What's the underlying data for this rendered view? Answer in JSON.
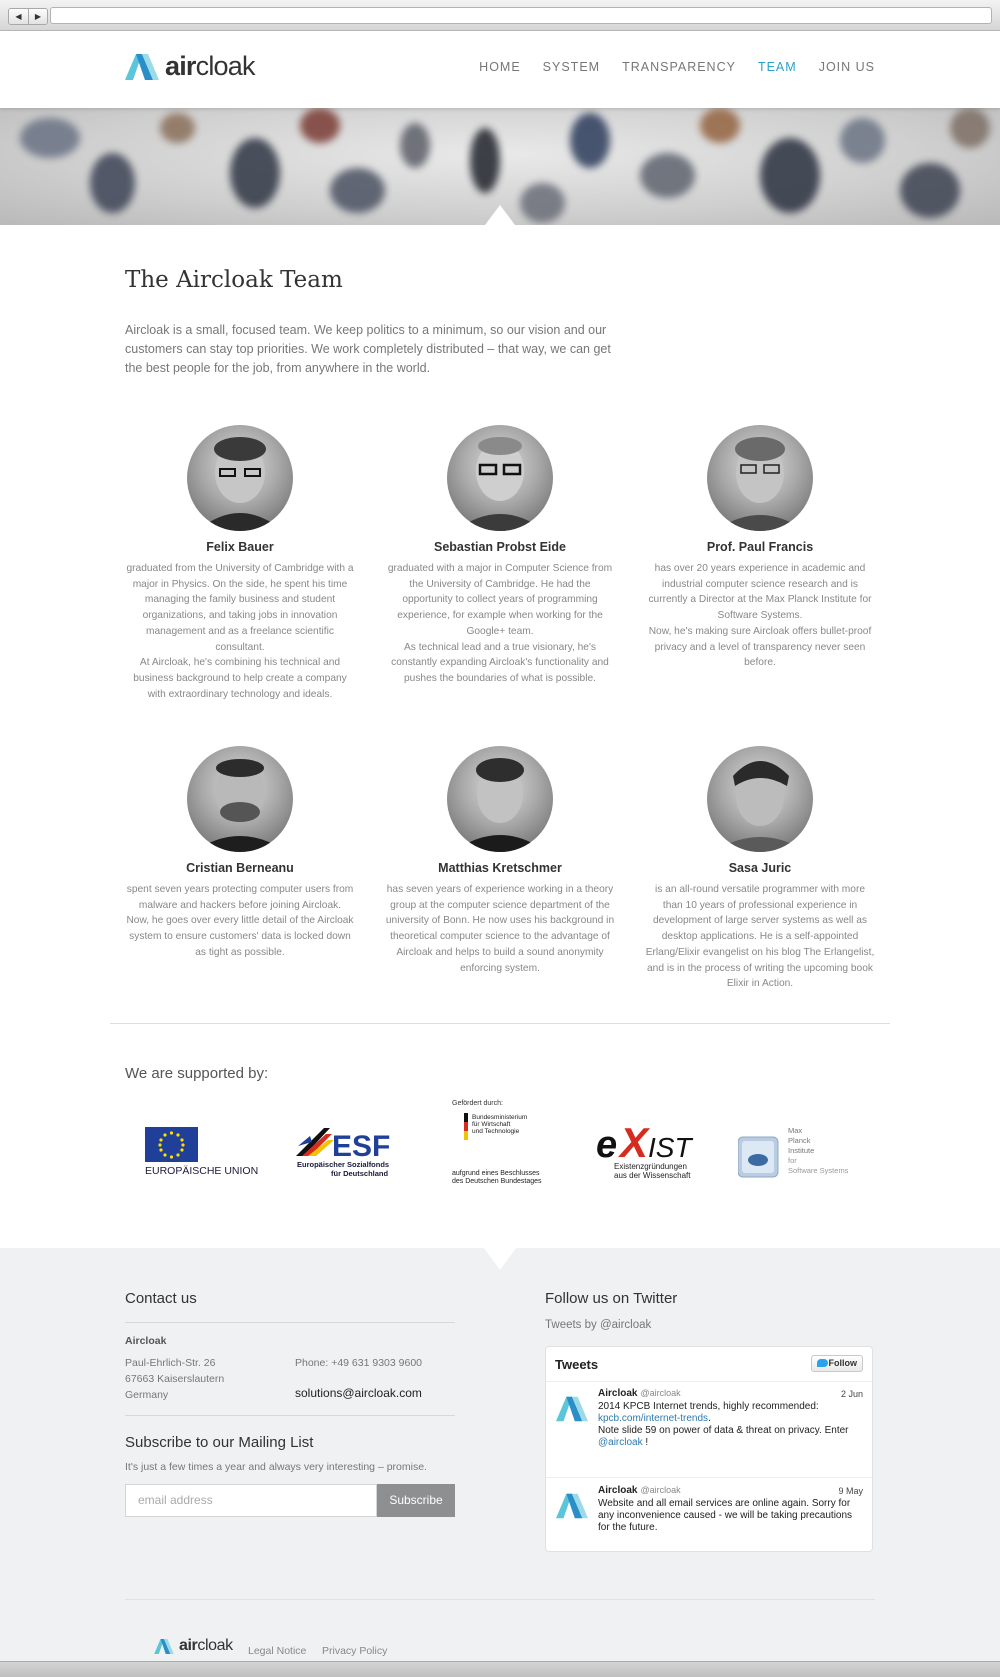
{
  "nav": {
    "logo_prefix": "air",
    "logo_suffix": "cloak",
    "items": [
      "HOME",
      "SYSTEM",
      "TRANSPARENCY",
      "TEAM",
      "JOIN US"
    ],
    "active": "TEAM",
    "accent_color": "#2aa3c9"
  },
  "main": {
    "title": "The Aircloak Team",
    "intro": "Aircloak is a small, focused team. We keep politics to a minimum, so our vision and our customers can stay top priorities. We work completely distributed – that way, we can get the best people for the job, from anywhere in the world."
  },
  "team": [
    {
      "name": "Felix Bauer",
      "bio": "graduated from the University of Cambridge with a major in Physics. On the side, he spent his time managing the family business and student organizations, and taking jobs in innovation management and as a freelance scientific consultant.\nAt Aircloak, he's combining his technical and business background to help create a company with extraordinary technology and ideals."
    },
    {
      "name": "Sebastian Probst Eide",
      "bio": "graduated with a major in Computer Science from the University of Cambridge. He had the opportunity to collect years of programming experience, for example when working for the Google+ team.\nAs technical lead and a true visionary, he's constantly expanding Aircloak's functionality and pushes the boundaries of what is possible."
    },
    {
      "name": "Prof. Paul Francis",
      "bio": "has over 20 years experience in academic and industrial computer science research and is currently a Director at the Max Planck Institute for Software Systems.\nNow, he's making sure Aircloak offers bullet-proof privacy and a level of transparency never seen before."
    },
    {
      "name": "Cristian Berneanu",
      "bio": "spent seven years protecting computer users from malware and hackers before joining Aircloak.\nNow, he goes over every little detail of the Aircloak system to ensure customers' data is locked down as tight as possible."
    },
    {
      "name": "Matthias Kretschmer",
      "bio": "has seven years of experience working in a theory group at the computer science department of the university of Bonn. He now uses his background in theoretical computer science to the advantage of Aircloak and helps to build a sound anonymity enforcing system."
    },
    {
      "name": "Sasa Juric",
      "bio": "is an all-round versatile programmer with more than 10 years of professional experience in development of large server systems as well as desktop applications. He is a self-appointed Erlang/Elixir evangelist on his blog The Erlangelist, and is in the process of writing the upcoming book Elixir in Action."
    }
  ],
  "support": {
    "title": "We are supported by:",
    "eu": "EUROPÄISCHE UNION",
    "esf_big": "ESF",
    "esf_line1": "Europäischer Sozialfonds",
    "esf_line2": "für Deutschland",
    "bmwi_top": "Gefördert durch:",
    "bmwi_line1": "Bundesministerium",
    "bmwi_line2": "für Wirtschaft",
    "bmwi_line3": "und Technologie",
    "bmwi_bottom1": "aufgrund eines Beschlusses",
    "bmwi_bottom2": "des Deutschen Bundestages",
    "exist_e": "e",
    "exist_x": "X",
    "exist_ist": "IST",
    "exist_line1": "Existenzgründungen",
    "exist_line2": "aus der Wissenschaft",
    "mpi_line1": "Max",
    "mpi_line2": "Planck",
    "mpi_line3": "Institute",
    "mpi_line4": "for",
    "mpi_line5": "Software Systems"
  },
  "footer": {
    "contact_title": "Contact us",
    "company": "Aircloak",
    "street": "Paul-Ehrlich-Str. 26",
    "city": "67663 Kaiserslautern",
    "country": "Germany",
    "phone": "Phone: +49 631 9303 9600",
    "email": "solutions@aircloak.com",
    "mailing_title": "Subscribe to our Mailing List",
    "mailing_text": "It's just a few times a year and always very interesting – promise.",
    "email_placeholder": "email address",
    "subscribe_label": "Subscribe",
    "twitter_title": "Follow us on Twitter",
    "tweets_by": "Tweets by @aircloak",
    "legal": "Legal Notice",
    "privacy": "Privacy Policy"
  },
  "twitter": {
    "header": "Tweets",
    "follow_label": "Follow",
    "tweets": [
      {
        "author": "Aircloak",
        "handle": "@aircloak",
        "date": "2 Jun",
        "line1": "2014 KPCB Internet trends, highly recommended:",
        "link": "kpcb.com/internet-trends",
        "line2": "Note slide 59 on power of data & threat on privacy. Enter",
        "mention": "@aircloak",
        "end": "!"
      },
      {
        "author": "Aircloak",
        "handle": "@aircloak",
        "date": "9 May",
        "text": "Website and all email services are online again. Sorry for any inconvenience caused - we will be taking precautions for the future."
      }
    ]
  }
}
